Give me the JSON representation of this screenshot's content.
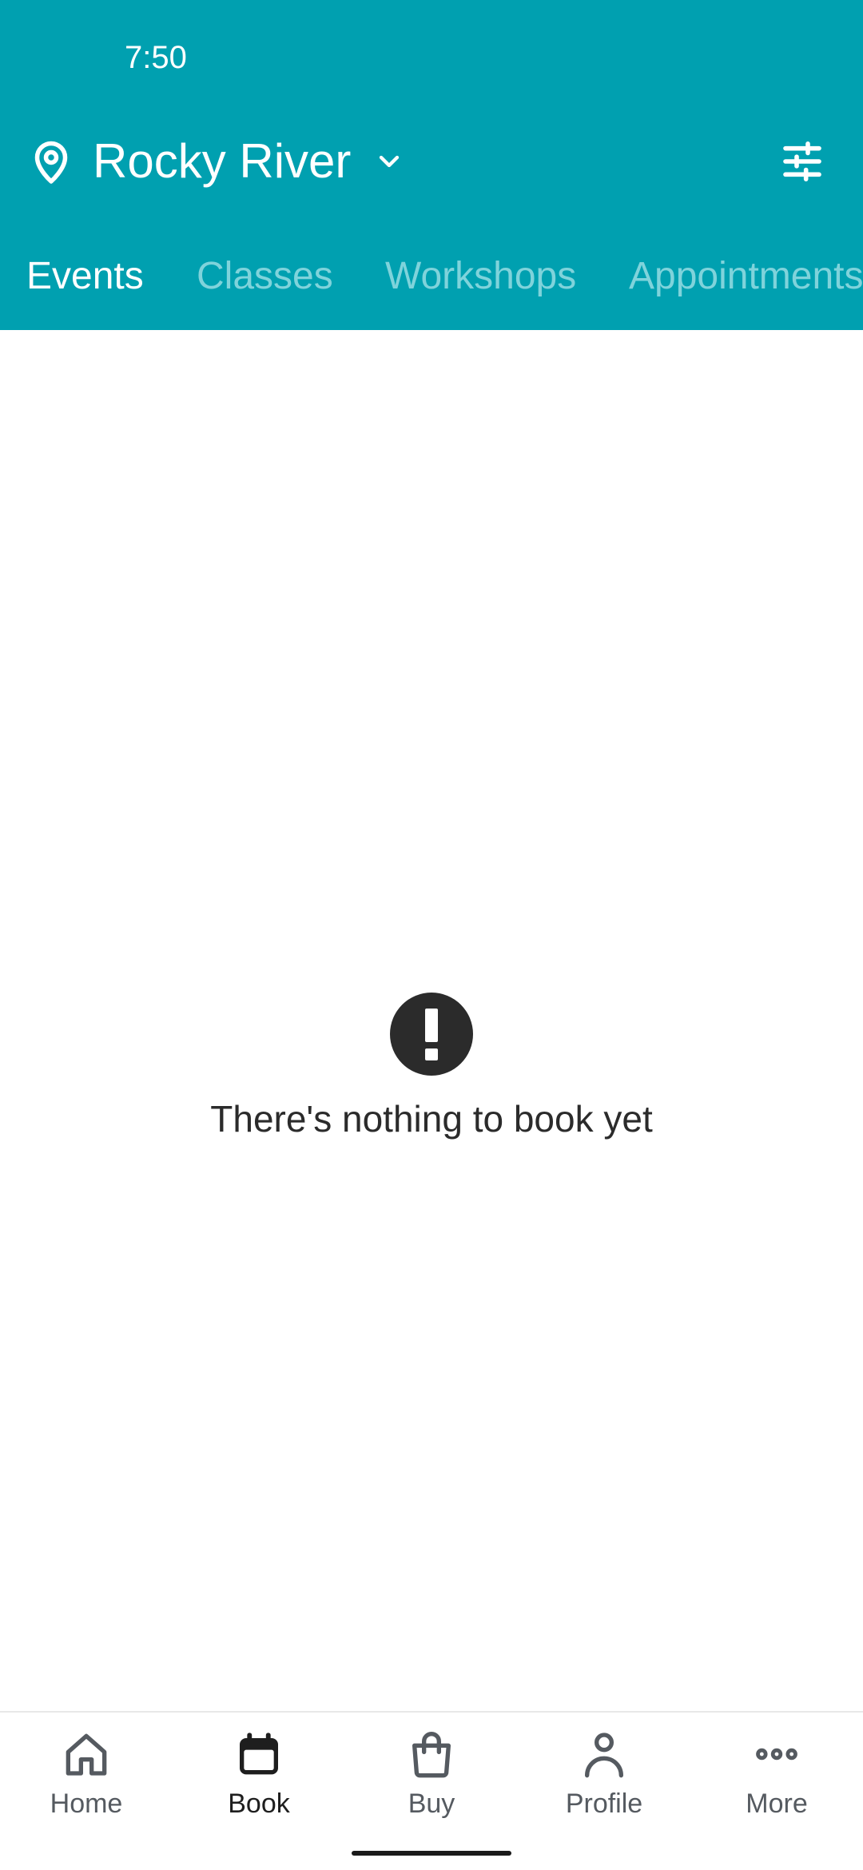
{
  "status_bar": {
    "time": "7:50"
  },
  "header": {
    "location": "Rocky River",
    "icons": {
      "location": "map-pin-icon",
      "dropdown": "chevron-down-icon",
      "filter": "sliders-icon"
    },
    "background_color": "#00a0b0"
  },
  "tabs": [
    {
      "label": "Events",
      "active": true
    },
    {
      "label": "Classes",
      "active": false
    },
    {
      "label": "Workshops",
      "active": false
    },
    {
      "label": "Appointments",
      "active": false
    }
  ],
  "empty_state": {
    "icon": "exclamation-circle-icon",
    "message": "There's nothing to book yet"
  },
  "bottom_nav": {
    "items": [
      {
        "label": "Home",
        "icon": "home-icon",
        "active": false
      },
      {
        "label": "Book",
        "icon": "calendar-icon",
        "active": true
      },
      {
        "label": "Buy",
        "icon": "shopping-bag-icon",
        "active": false
      },
      {
        "label": "Profile",
        "icon": "user-icon",
        "active": false
      },
      {
        "label": "More",
        "icon": "more-horizontal-icon",
        "active": false
      }
    ]
  }
}
